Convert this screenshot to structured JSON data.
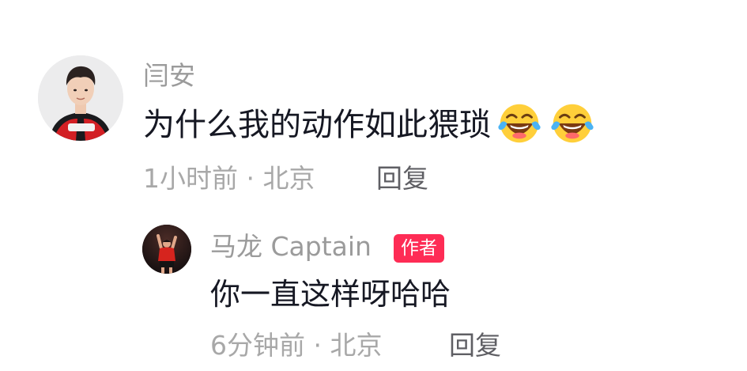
{
  "comments": [
    {
      "author": "闫安",
      "text": "为什么我的动作如此猥琐",
      "emojis": [
        "laughing-tears-icon",
        "laughing-tears-icon"
      ],
      "time": "1小时前",
      "location": "北京",
      "meta": "1小时前 · 北京",
      "reply_label": "回复"
    },
    {
      "author": "马龙 Captain",
      "badge": "作者",
      "text": "你一直这样呀哈哈",
      "time": "6分钟前",
      "location": "北京",
      "meta": "6分钟前 · 北京",
      "reply_label": "回复"
    }
  ],
  "colors": {
    "name": "#9b9b9b",
    "text": "#161823",
    "meta": "#a8a8a8",
    "reply": "#5f5f64",
    "badge_bg": "#fe2c55"
  }
}
